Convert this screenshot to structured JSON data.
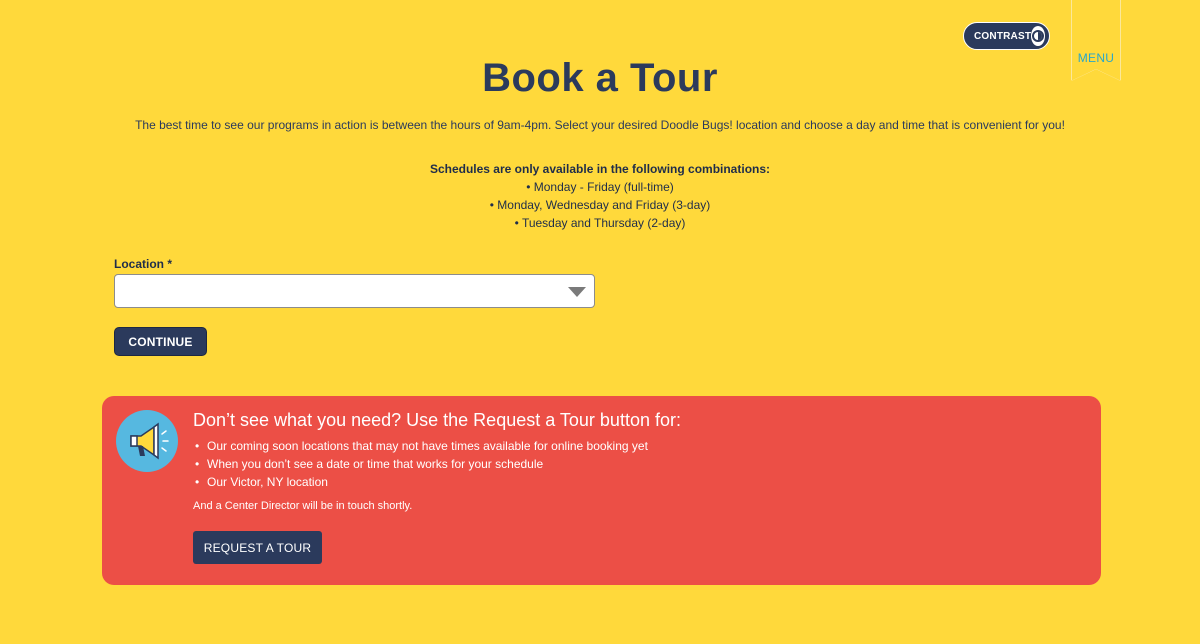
{
  "header": {
    "contrast_label": "CONTRAST",
    "menu_label": "MENU"
  },
  "page": {
    "title": "Book a Tour",
    "intro": "The best time to see our programs in action is between the hours of 9am-4pm. Select your desired Doodle Bugs! location and choose a day and time that is convenient for you!"
  },
  "schedules": {
    "heading": "Schedules are only available in the following combinations:",
    "items": [
      "• Monday - Friday (full-time)",
      "• Monday, Wednesday and Friday (3-day)",
      "• Tuesday and Thursday (2-day)"
    ]
  },
  "form": {
    "location_label": "Location *",
    "location_value": "",
    "continue_label": "CONTINUE"
  },
  "promo": {
    "title": "Don’t see what you need? Use the Request a Tour button for:",
    "items": [
      "Our coming soon locations that may not have times available for online booking yet",
      "When you don’t see a date or time that works for your schedule",
      "Our Victor, NY location"
    ],
    "footnote": "And a Center Director will be in touch shortly.",
    "button_label": "REQUEST A TOUR"
  },
  "colors": {
    "background": "#FFD93B",
    "navy": "#2B3A5C",
    "promo_red": "#EC4F46",
    "icon_blue": "#56B8E0",
    "menu_teal": "#2AA7C9"
  }
}
